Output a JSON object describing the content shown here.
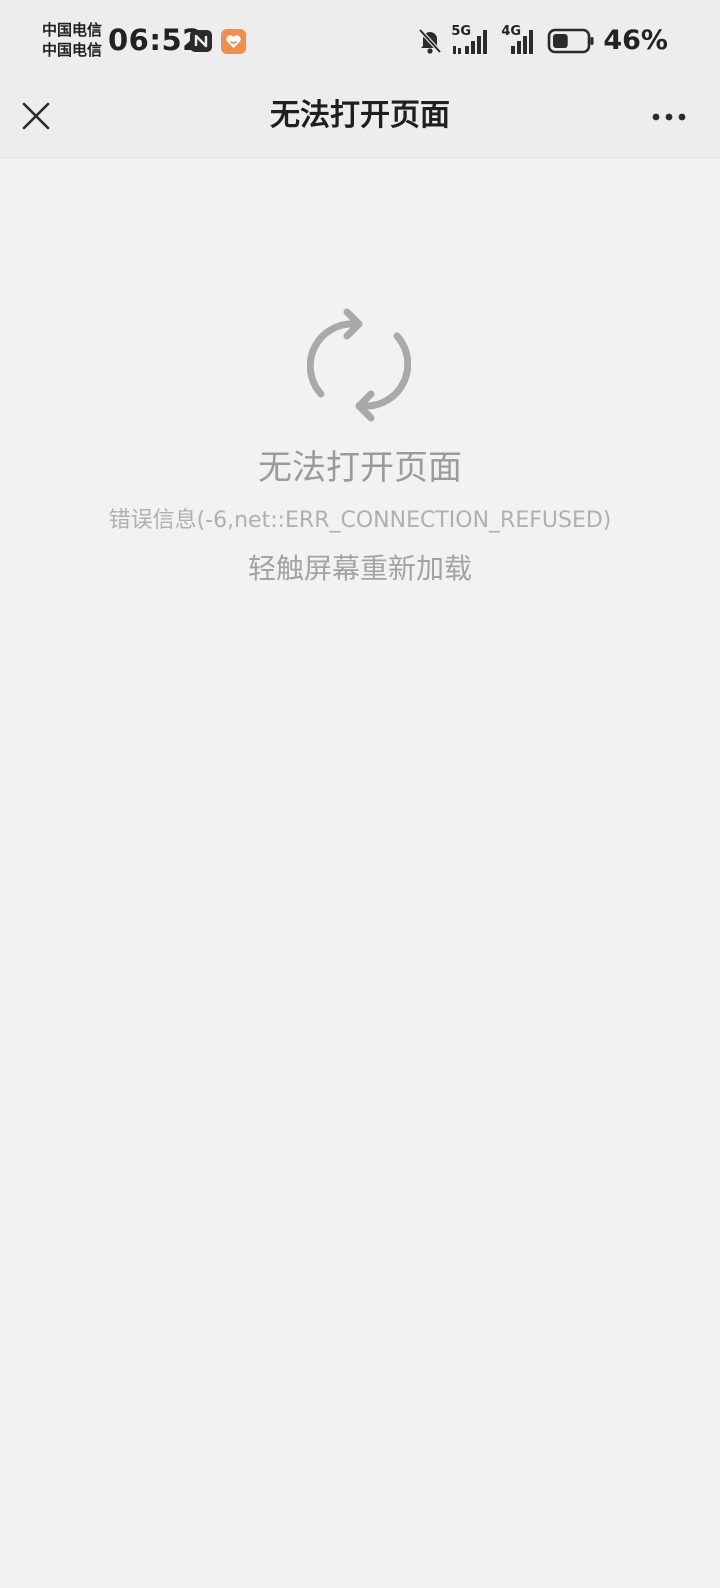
{
  "status_bar": {
    "carrier_1": "中国电信",
    "carrier_2": "中国电信",
    "time": "06:52",
    "network_1": "5G",
    "network_2": "4G",
    "battery_percent": "46%",
    "battery_level": 0.46,
    "icons": [
      "nfc-icon",
      "app-badge-icon",
      "bell-off-icon",
      "signal-5g-icon",
      "signal-4g-icon",
      "battery-icon"
    ]
  },
  "nav": {
    "title": "无法打开页面",
    "icons": [
      "close-icon",
      "more-icon"
    ]
  },
  "error": {
    "icon": "refresh-icon",
    "title": "无法打开页面",
    "detail": "错误信息(-6,net::ERR_CONNECTION_REFUSED)",
    "reload_hint": "轻触屏幕重新加载"
  },
  "colors": {
    "background": "#f2f2f2",
    "bar_background": "#ededed",
    "muted_text": "#9b9b9b",
    "app_badge": "#ef8f4d"
  }
}
